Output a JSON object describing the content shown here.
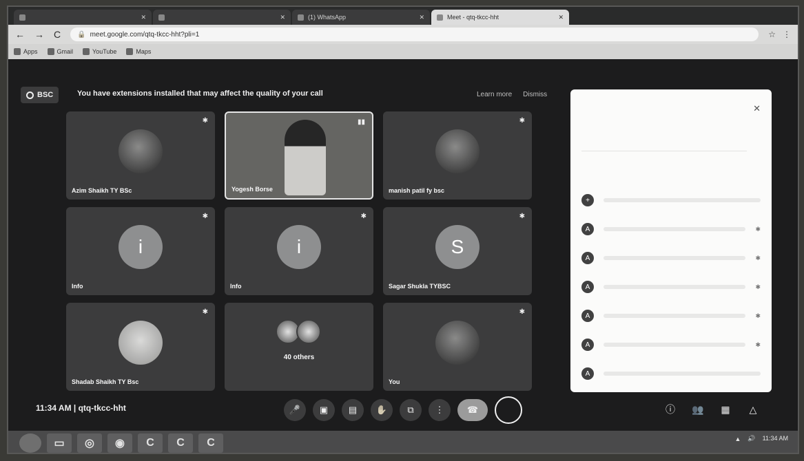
{
  "browser": {
    "tabs": [
      {
        "label": "",
        "active": false
      },
      {
        "label": "",
        "active": false
      },
      {
        "label": "(1) WhatsApp",
        "active": false
      },
      {
        "label": "Meet - qtq-tkcc-hht",
        "active": true
      }
    ],
    "url": "meet.google.com/qtq-tkcc-hht?pli=1",
    "bookmarks": [
      "Apps",
      "Gmail",
      "YouTube",
      "Maps"
    ]
  },
  "meet": {
    "code_badge": "BSC",
    "banner": "You have extensions installed that may affect the quality of your call",
    "banner_learn": "Learn more",
    "banner_dismiss": "Dismiss",
    "tiles": [
      {
        "name": "Azim Shaikh TY BSc"
      },
      {
        "name": "Yogesh Borse"
      },
      {
        "name": "manish patil fy bsc"
      },
      {
        "name": "Info",
        "initial": "i"
      },
      {
        "name": "Info",
        "initial": "i"
      },
      {
        "name": "Sagar Shukla TYBSC",
        "initial": "S"
      },
      {
        "name": "Shadab Shaikh TY Bsc"
      },
      {
        "name": "",
        "others": "40 others"
      },
      {
        "name": "You"
      }
    ],
    "time_code": "11:34 AM  |  qtq-tkcc-hht"
  },
  "taskbar": {
    "time": "11:34 AM"
  }
}
